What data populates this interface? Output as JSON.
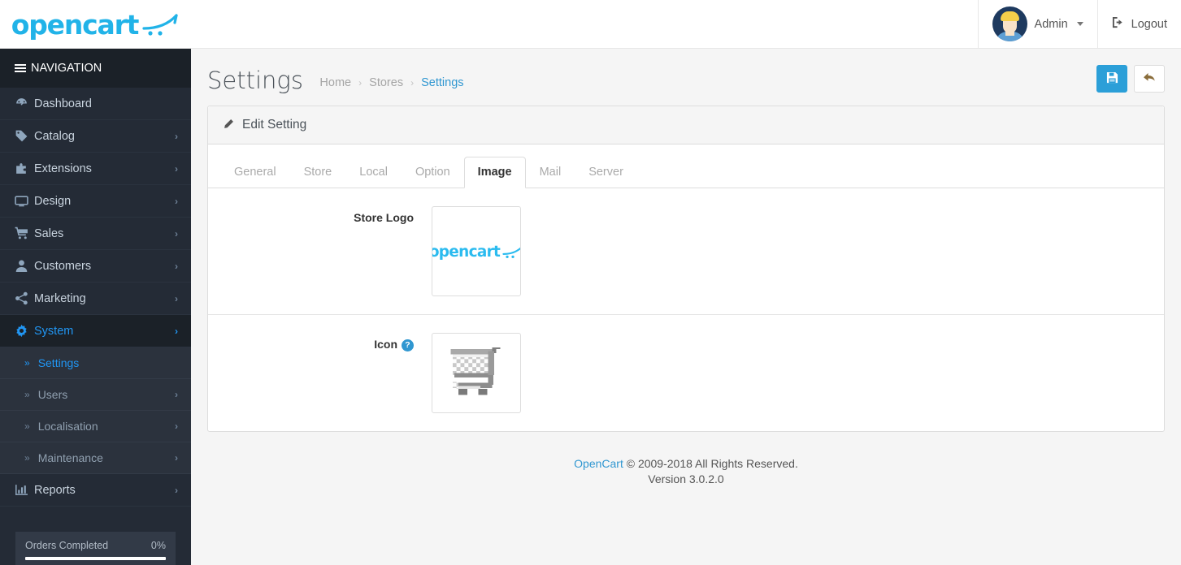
{
  "header": {
    "brand": "opencart",
    "user_name": "Admin",
    "logout_label": "Logout"
  },
  "sidebar": {
    "nav_title": "NAVIGATION",
    "items": [
      {
        "label": "Dashboard",
        "icon": "dashboard-icon",
        "arrow": "",
        "active": false
      },
      {
        "label": "Catalog",
        "icon": "tag-icon",
        "arrow": "›",
        "active": false
      },
      {
        "label": "Extensions",
        "icon": "puzzle-icon",
        "arrow": "›",
        "active": false
      },
      {
        "label": "Design",
        "icon": "monitor-icon",
        "arrow": "›",
        "active": false
      },
      {
        "label": "Sales",
        "icon": "cart-icon",
        "arrow": "›",
        "active": false
      },
      {
        "label": "Customers",
        "icon": "user-icon",
        "arrow": "›",
        "active": false
      },
      {
        "label": "Marketing",
        "icon": "share-icon",
        "arrow": "›",
        "active": false
      },
      {
        "label": "System",
        "icon": "gear-icon",
        "arrow": "›",
        "active": true
      }
    ],
    "sub_items": [
      {
        "label": "Settings",
        "arrow": "",
        "current": true
      },
      {
        "label": "Users",
        "arrow": "›",
        "current": false
      },
      {
        "label": "Localisation",
        "arrow": "›",
        "current": false
      },
      {
        "label": "Maintenance",
        "arrow": "›",
        "current": false
      }
    ],
    "items_after": [
      {
        "label": "Reports",
        "icon": "bar-chart-icon",
        "arrow": "›",
        "active": false
      }
    ],
    "progress": {
      "label": "Orders Completed",
      "percent": "0%",
      "value": 0
    }
  },
  "page": {
    "title": "Settings",
    "breadcrumb": [
      {
        "label": "Home",
        "last": false
      },
      {
        "label": "Stores",
        "last": false
      },
      {
        "label": "Settings",
        "last": true
      }
    ],
    "breadcrumb_separator": "›",
    "save_icon": "floppy-save-icon",
    "back_icon": "reply-arrow-icon"
  },
  "panel": {
    "heading": "Edit Setting",
    "heading_icon": "pencil-icon",
    "tabs": [
      {
        "label": "General",
        "active": false
      },
      {
        "label": "Store",
        "active": false
      },
      {
        "label": "Local",
        "active": false
      },
      {
        "label": "Option",
        "active": false
      },
      {
        "label": "Image",
        "active": true
      },
      {
        "label": "Mail",
        "active": false
      },
      {
        "label": "Server",
        "active": false
      }
    ],
    "fields": [
      {
        "label": "Store Logo",
        "has_help": false,
        "help_glyph": "",
        "thumb_kind": "store-logo"
      },
      {
        "label": "Icon",
        "has_help": true,
        "help_glyph": "?",
        "thumb_kind": "favicon-cart"
      }
    ]
  },
  "footer": {
    "link": "OpenCart",
    "copyright": "© 2009-2018 All Rights Reserved.",
    "version": "Version 3.0.2.0"
  },
  "colors": {
    "brand_blue": "#21b3e8",
    "sidebar_bg": "#242b36",
    "accent": "#3097d1",
    "primary_button": "#2b9fd8"
  }
}
